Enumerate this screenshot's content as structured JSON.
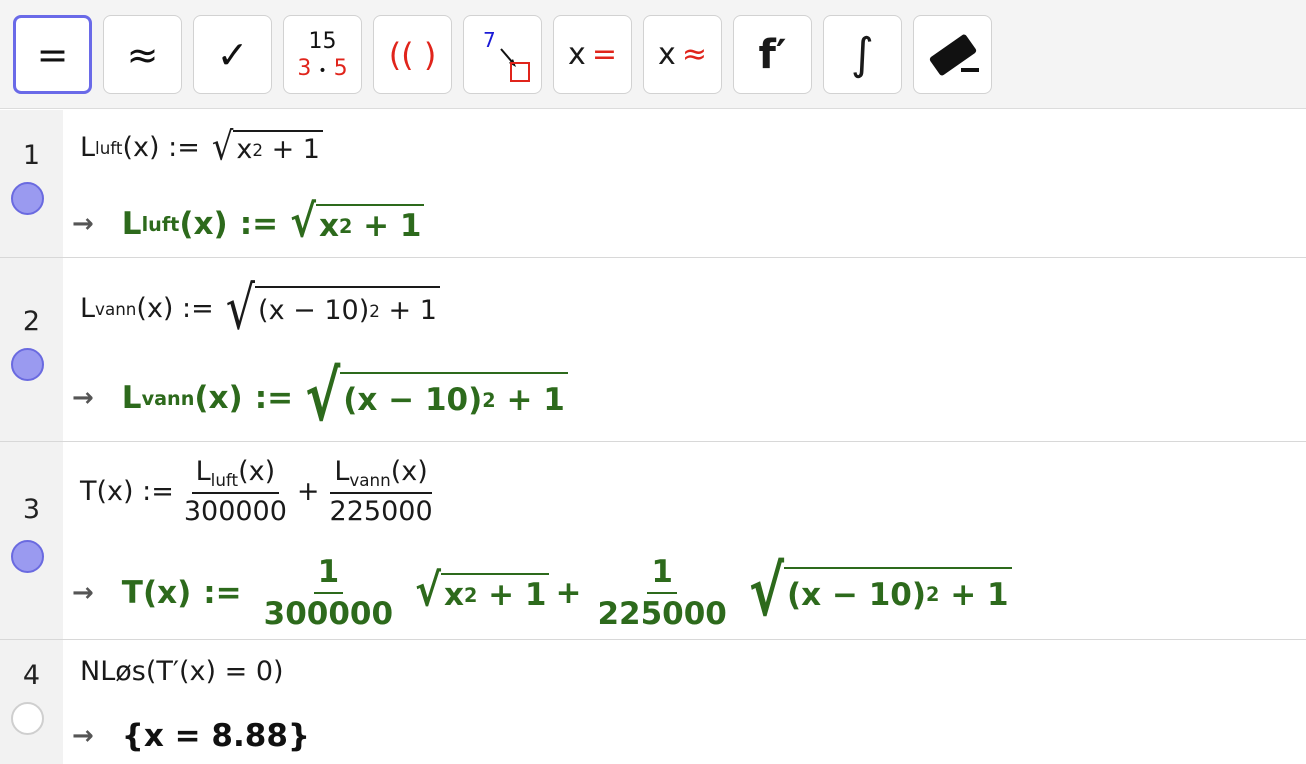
{
  "toolbar": {
    "buttons": [
      {
        "name": "evaluate",
        "label": "="
      },
      {
        "name": "numeric",
        "label": "≈"
      },
      {
        "name": "keep-input",
        "label": "✓"
      },
      {
        "name": "factor",
        "top": "15",
        "left": "3",
        "dot": "•",
        "right": "5"
      },
      {
        "name": "expand",
        "left": "((",
        "right": ")"
      },
      {
        "name": "substitute",
        "value": "7"
      },
      {
        "name": "solve",
        "var": "x",
        "sym": "="
      },
      {
        "name": "solve-numeric",
        "var": "x",
        "sym": "≈"
      },
      {
        "name": "derivative",
        "label": "f′"
      },
      {
        "name": "integral",
        "label": "∫"
      },
      {
        "name": "delete",
        "icon": "eraser-icon"
      }
    ]
  },
  "rows": [
    {
      "number": "1",
      "input": {
        "L": "L",
        "sub": "luft",
        "rest": "(x) :=",
        "radicand": "x",
        "exp": "2",
        "tail": "+ 1"
      },
      "output": {
        "arrow": "→",
        "L": "L",
        "sub": "luft",
        "rest": "(x)",
        "assign": ":=",
        "radicand": "x",
        "exp": "2",
        "tail": "+ 1"
      },
      "dot": "filled"
    },
    {
      "number": "2",
      "input": {
        "L": "L",
        "sub": "vann",
        "rest": "(x) :=",
        "radicand": "(x − 10)",
        "exp": "2",
        "tail": "+ 1"
      },
      "output": {
        "arrow": "→",
        "L": "L",
        "sub": "vann",
        "rest": "(x)",
        "assign": ":=",
        "radicand": "(x − 10)",
        "exp": "2",
        "tail": "+ 1"
      },
      "dot": "filled"
    },
    {
      "number": "3",
      "input": {
        "lhs": "T(x) :=",
        "n1L": "L",
        "n1sub": "luft",
        "n1rest": "(x)",
        "d1": "300000",
        "plus": "+",
        "n2L": "L",
        "n2sub": "vann",
        "n2rest": "(x)",
        "d2": "225000"
      },
      "output": {
        "arrow": "→",
        "lhs": "T(x)",
        "assign": ":=",
        "n1": "1",
        "d1": "300000",
        "r1": "x",
        "r1exp": "2",
        "r1tail": "+ 1",
        "plus": "+",
        "n2": "1",
        "d2": "225000",
        "r2": "(x − 10)",
        "r2exp": "2",
        "r2tail": "+ 1"
      },
      "dot": "filled"
    },
    {
      "number": "4",
      "input": {
        "text": "NLøs(T′(x)  =  0)"
      },
      "output": {
        "arrow": "→",
        "text": "{x = 8.88}"
      },
      "dot": "empty"
    }
  ],
  "actions": {
    "undo": "undo-icon",
    "redo": "redo-icon"
  }
}
